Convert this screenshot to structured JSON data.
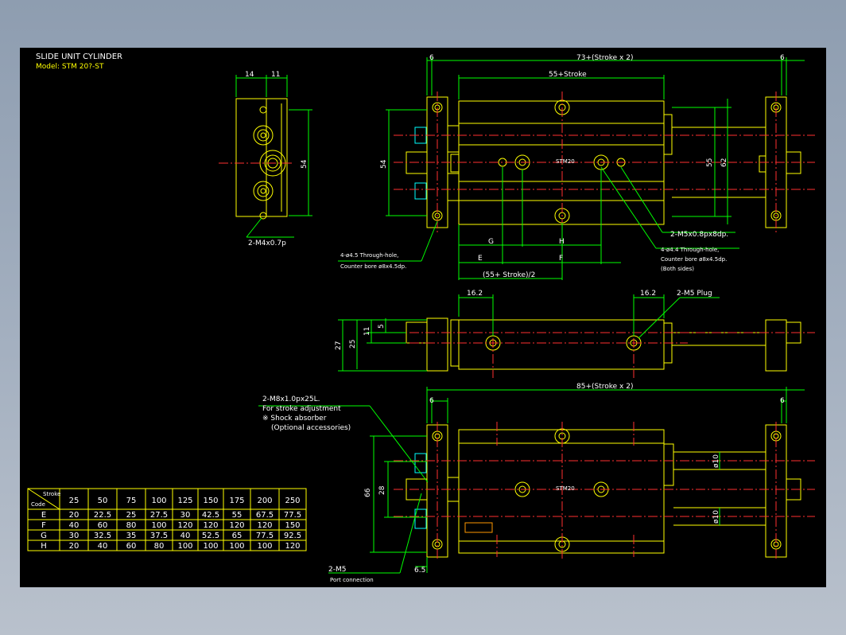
{
  "title": {
    "line1": "SLIDE UNIT CYLINDER",
    "line2": "Model: STM 20?-ST"
  },
  "dims": {
    "left_14": "14",
    "left_11": "11",
    "left_54": "54",
    "left_m4": "2-M4x0.7p",
    "top_6a": "6",
    "top_total": "73+(Stroke x 2)",
    "top_6b": "6",
    "top_55": "55+Stroke",
    "top_54": "54",
    "top_55v": "55",
    "top_62": "62",
    "g": "G",
    "h": "H",
    "e": "E",
    "f": "F",
    "half": "(55+ Stroke)/2",
    "m5_deep": "2-M5x0.8px8dp.",
    "hole44_1": "4-ø4.4 Through-hole,",
    "hole44_2": "Counter bore ø8x4.5dp.",
    "hole44_3": "(Both sides)",
    "hole45_1": "4-ø4.5 Through-hole,",
    "hole45_2": "Counter bore ø8x4.5dp.",
    "label_stm20": "STM20",
    "mid_162a": "16.2",
    "mid_162b": "16.2",
    "mid_plug": "2-M5 Plug",
    "mid_27": "27",
    "mid_25": "25",
    "mid_11": "11",
    "mid_5": "5",
    "bot_total": "85+(Stroke x 2)",
    "bot_6a": "6",
    "bot_6b": "6",
    "bot_m8_1": "2-M8x1.0px25L.",
    "bot_m8_2": "For stroke adjustment",
    "bot_m8_3": "※ Shock absorber",
    "bot_m8_4": "(Optional accessories)",
    "bot_66": "66",
    "bot_28": "28",
    "bot_d10a": "ø10",
    "bot_d10b": "ø10",
    "bot_m5": "2-M5",
    "bot_port": "Port connection",
    "bot_65": "6.5"
  },
  "table": {
    "corner_top": "Stroke",
    "corner_bottom": "Code",
    "strokes": [
      "25",
      "50",
      "75",
      "100",
      "125",
      "150",
      "175",
      "200",
      "250"
    ],
    "rows": [
      {
        "code": "E",
        "values": [
          "20",
          "22.5",
          "25",
          "27.5",
          "30",
          "42.5",
          "55",
          "67.5",
          "77.5"
        ]
      },
      {
        "code": "F",
        "values": [
          "40",
          "60",
          "80",
          "100",
          "120",
          "120",
          "120",
          "120",
          "150"
        ]
      },
      {
        "code": "G",
        "values": [
          "30",
          "32.5",
          "35",
          "37.5",
          "40",
          "52.5",
          "65",
          "77.5",
          "92.5"
        ]
      },
      {
        "code": "H",
        "values": [
          "20",
          "40",
          "60",
          "80",
          "100",
          "100",
          "100",
          "100",
          "120"
        ]
      }
    ]
  },
  "colors": {
    "background": "#000000",
    "outline": "#ffff00",
    "dimension": "#00ff00",
    "centerline": "#ff3030",
    "text": "#ffffff",
    "accent": "#00ffff"
  }
}
